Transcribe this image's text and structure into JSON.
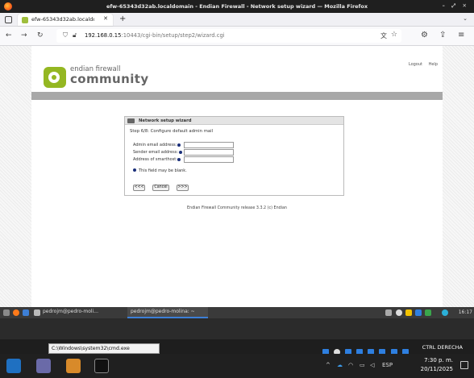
{
  "browser": {
    "window_title": "efw-65343d32ab.localdomain - Endian Firewall - Network setup wizard — Mozilla Firefox",
    "window_controls": "– ⤢ ✕",
    "tab_label": "efw-65343d32ab.localdo",
    "url_host": "192.168.0.15",
    "url_rest": ":10443/cgi-bin/setup/step2/wizard.cgi"
  },
  "page": {
    "logo_line1": "endian firewall",
    "logo_line2": "community",
    "logout": "Logout",
    "help": "Help",
    "panel_title": "Network setup wizard",
    "step": "Step 6/8: Configure default admin mail",
    "fields": [
      {
        "label": "Admin email address:",
        "value": ""
      },
      {
        "label": "Sender email address:",
        "value": ""
      },
      {
        "label": "Address of smarthost:",
        "value": ""
      }
    ],
    "note": "This field may be blank.",
    "buttons": {
      "prev": "<<<",
      "cancel": "Cancel",
      "next": ">>>"
    },
    "footer": "Endian Firewall Community release 3.3.2 (c) Endian"
  },
  "linux_taskbar": {
    "item1": "pedrojm@pedro-moli...",
    "item2": "pedrojm@pedro-molina: ~",
    "clock": "16:17"
  },
  "cmd_window_title": "C:\\Windows\\system32\\cmd.exe",
  "ctrl_label": "CTRL DERECHA",
  "windows_taskbar": {
    "lang": "ESP",
    "time": "7:30 p. m.",
    "date": "20/11/2025"
  },
  "colors": {
    "endian_green": "#94b722",
    "required_dot": "#1a2f7a",
    "accent_blue": "#3d7fd6"
  }
}
